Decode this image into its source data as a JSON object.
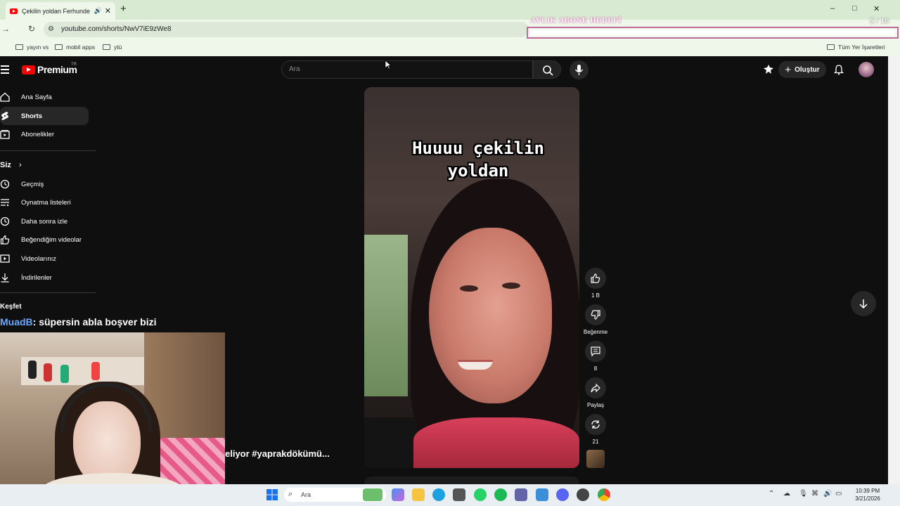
{
  "browser": {
    "tab_title": "Çekilin yoldan Ferhunde ge",
    "new_tab": "+",
    "url": "youtube.com/shorts/NwV7iE9zWe8",
    "window_controls": {
      "minimize": "–",
      "maximize": "□",
      "close": "✕"
    },
    "bookmarks": [
      "yayın vs",
      "mobil apps",
      "ytü"
    ],
    "all_bookmarks": "Tüm Yer İşaretleri"
  },
  "overlay_goal": {
    "label": "AYLIK ABONE HEDEFİ",
    "count": "$ / 10"
  },
  "youtube": {
    "brand": "Premium",
    "region": "TR",
    "search_placeholder": "Ara",
    "create_label": "Oluştur",
    "sidebar": {
      "main": [
        {
          "label": "Ana Sayfa",
          "icon": "home-icon"
        },
        {
          "label": "Shorts",
          "icon": "shorts-icon",
          "active": true
        },
        {
          "label": "Abonelikler",
          "icon": "subscriptions-icon"
        }
      ],
      "you_header": "Siz",
      "you": [
        {
          "label": "Geçmiş",
          "icon": "history-icon"
        },
        {
          "label": "Oynatma listeleri",
          "icon": "playlist-icon"
        },
        {
          "label": "Daha sonra izle",
          "icon": "clock-icon"
        },
        {
          "label": "Beğendiğim videolar",
          "icon": "thumb-up-icon"
        },
        {
          "label": "Videolarınız",
          "icon": "your-videos-icon"
        },
        {
          "label": "İndirilenler",
          "icon": "download-icon"
        }
      ],
      "explore_header": "Keşfet"
    },
    "short": {
      "caption_line1": "Huuuu çekilin",
      "caption_line2": "yoldan",
      "title_fragment": "eliyor #yaprakdökümü..."
    },
    "actions": {
      "likes": "1 B",
      "dislike_label": "Beğenme",
      "comments": "8",
      "share_label": "Paylaş",
      "remix": "21"
    }
  },
  "stream_chat": {
    "user": "MuadB",
    "message": ": süpersin abla boşver bizi"
  },
  "taskbar": {
    "search_placeholder": "Ara",
    "time": "10:39 PM",
    "date": "3/21/2026"
  },
  "colors": {
    "youtube_red": "#ff0000",
    "dark_bg": "#0f0f0f",
    "chrome_tab_green": "#d9ead3",
    "chat_user": "#6aa8ff",
    "goal_border": "#c06a9a"
  }
}
